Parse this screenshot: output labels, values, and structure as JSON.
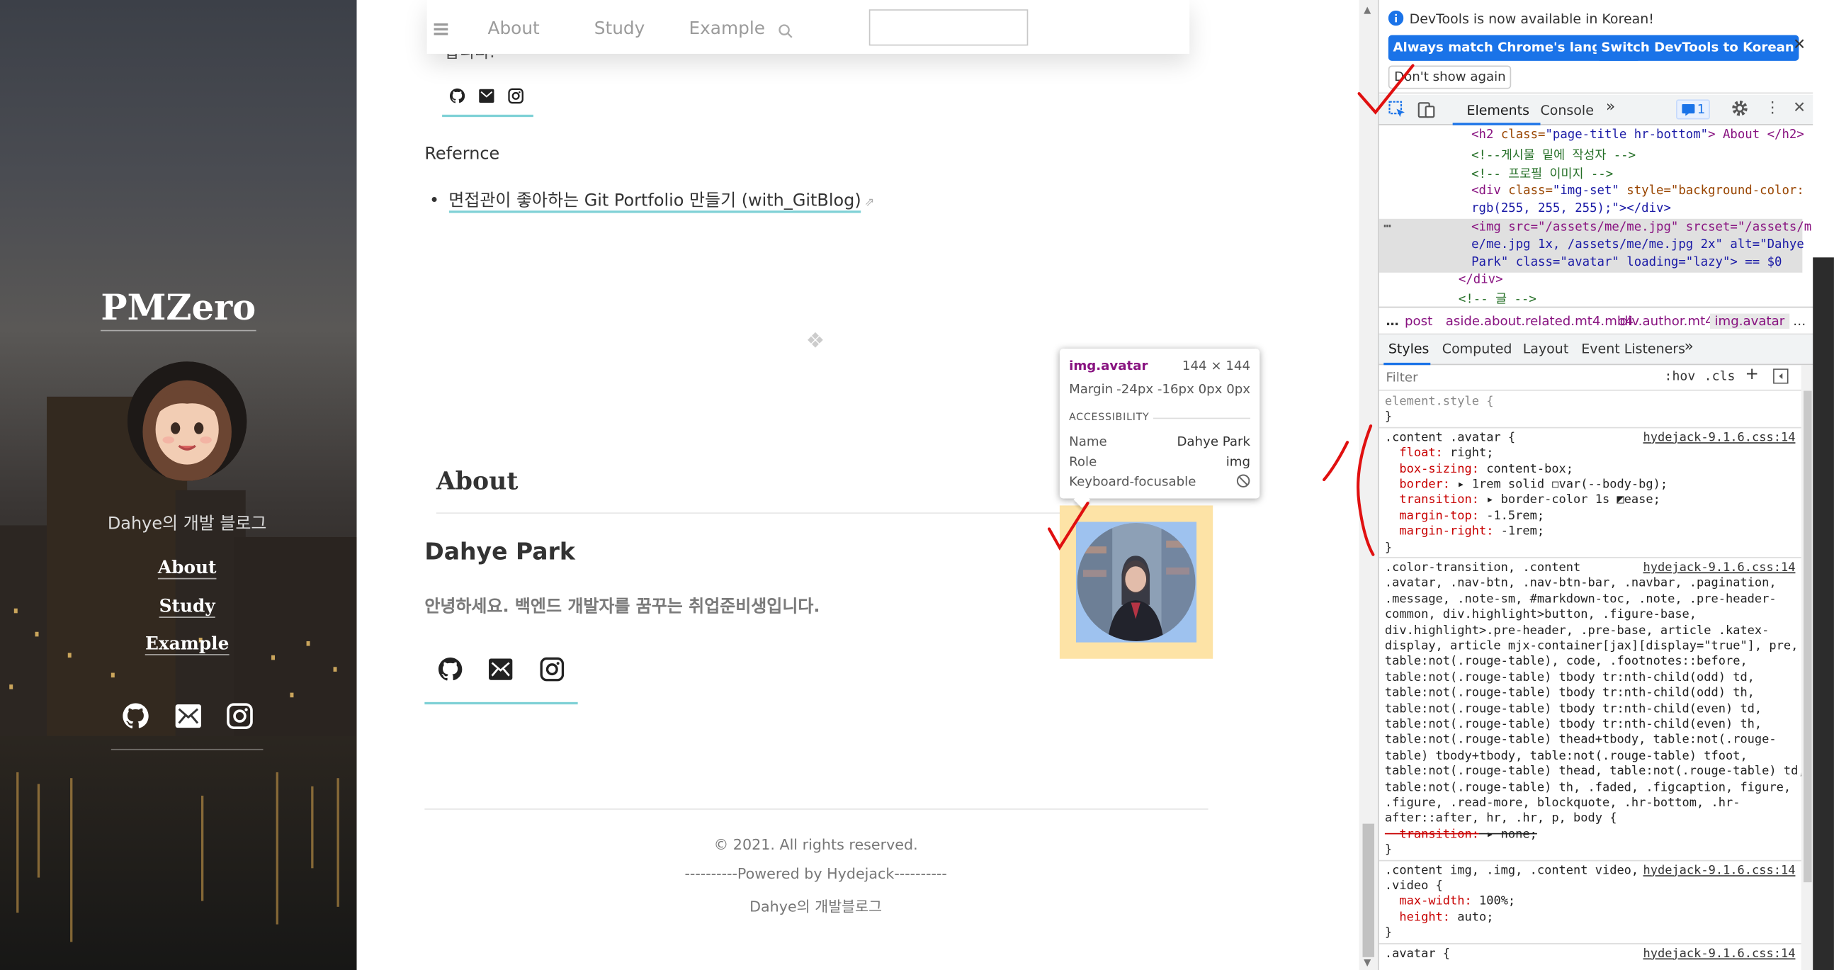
{
  "blog": {
    "title": "PMZero",
    "description": "Dahye의 개발 블로그",
    "nav": [
      "About",
      "Study",
      "Example"
    ],
    "social_icons": [
      "github-icon",
      "mail-icon",
      "instagram-icon"
    ]
  },
  "navbar": {
    "menu_icon": "hamburger-icon",
    "links": [
      "About",
      "Study",
      "Example"
    ],
    "search_placeholder": ""
  },
  "post": {
    "cut_text": "합니다.",
    "reference_label": "Refernce",
    "reference_link": "면접관이 좋아하는 Git Portfolio 만들기 (with_GitBlog)",
    "separator_glyph": "❖",
    "about_heading": "About",
    "author_name": "Dahye Park",
    "author_intro": "안녕하세요. 백엔드 개발자를 꿈꾸는 취업준비생입니다."
  },
  "footer": {
    "copyright": "© 2021. All rights reserved.",
    "powered": "----------Powered by Hydejack----------",
    "blog_name": "Dahye의 개발블로그"
  },
  "inspect_tooltip": {
    "selector": "img.avatar",
    "size": "144 × 144",
    "margin_label": "Margin",
    "margin_value": "-24px -16px 0px 0px",
    "accessibility_label": "ACCESSIBILITY",
    "name_label": "Name",
    "name_value": "Dahye Park",
    "role_label": "Role",
    "role_value": "img",
    "focus_label": "Keyboard-focusable"
  },
  "devtools": {
    "info_text": "DevTools is now available in Korean!",
    "btn_match": "Always match Chrome's language",
    "btn_switch": "Switch DevTools to Korean",
    "btn_dismiss": "Don't show again",
    "tabs": [
      "Elements",
      "Console"
    ],
    "issues_count": "1",
    "dom_lines": [
      {
        "tag": "<h2 ",
        "attr": "class=",
        "val": "\"page-title hr-bottom\"",
        "rest": "> About </h2>"
      },
      {
        "comment": "<!--게시물 밑에 작성자 -->"
      },
      {
        "comment": "<!-- 프로필 이미지 -->"
      },
      {
        "tag": "<div ",
        "attr": "class=",
        "val": "\"img-set\"",
        "rest": " style=\"background-color:"
      },
      {
        "plain": "rgb(255, 255, 255);\"></div>"
      },
      {
        "plain": "<img src=\"/assets/me/me.jpg\" srcset=\"/assets/m"
      },
      {
        "plain": "e/me.jpg 1x, /assets/me/me.jpg 2x\" alt=\"Dahye"
      },
      {
        "plain": "Park\" class=\"avatar\" loading=\"lazy\"> == $0"
      },
      {
        "plain": "</div>"
      },
      {
        "comment": "<!-- 글 -->"
      }
    ],
    "breadcrumbs": [
      "…",
      "post",
      "aside.about.related.mt4.mb4",
      "div.author.mt4",
      "img.avatar",
      "…"
    ],
    "style_tabs": [
      "Styles",
      "Computed",
      "Layout",
      "Event Listeners"
    ],
    "filter_placeholder": "Filter",
    "hov": ":hov",
    "cls": ".cls",
    "css_lines": [
      "element.style {",
      "}",
      ".content .avatar {",
      "  float: right;",
      "  box-sizing: content-box;",
      "  border: ▸ 1rem solid ◻var(--body-bg);",
      "  transition: ▸ border-color 1s ◩ease;",
      "  margin-top: -1.5rem;",
      "  margin-right: -1rem;",
      "}",
      ".color-transition, .content",
      ".avatar, .nav-btn, .nav-btn-bar, .navbar, .pagination,",
      ".message, .note-sm, #markdown-toc, .note, .pre-header-",
      "common, div.highlight>button, .figure-base,",
      "div.highlight>.pre-header, .pre-base, article .katex-",
      "display, article mjx-container[jax][display=\"true\"], pre,",
      "table:not(.rouge-table), code, .footnotes::before,",
      "table:not(.rouge-table) tbody tr:nth-child(odd) td,",
      "table:not(.rouge-table) tbody tr:nth-child(odd) th,",
      "table:not(.rouge-table) tbody tr:nth-child(even) td,",
      "table:not(.rouge-table) tbody tr:nth-child(even) th,",
      "table:not(.rouge-table) thead+tbody, table:not(.rouge-",
      "table) tbody+tbody, table:not(.rouge-table) tfoot,",
      "table:not(.rouge-table) thead, table:not(.rouge-table) td,",
      "table:not(.rouge-table) th, .faded, .figcaption, figure,",
      ".figure, .read-more, blockquote, .hr-bottom, .hr-",
      "after::after, hr, .hr, p, body {",
      "  transition: ▸ none;",
      "}",
      ".content img, .img, .content video,",
      ".video {",
      "  max-width: 100%;",
      "  height: auto;",
      "}",
      ".avatar {"
    ],
    "css_source": "hydejack-9.1.6.css:14"
  }
}
